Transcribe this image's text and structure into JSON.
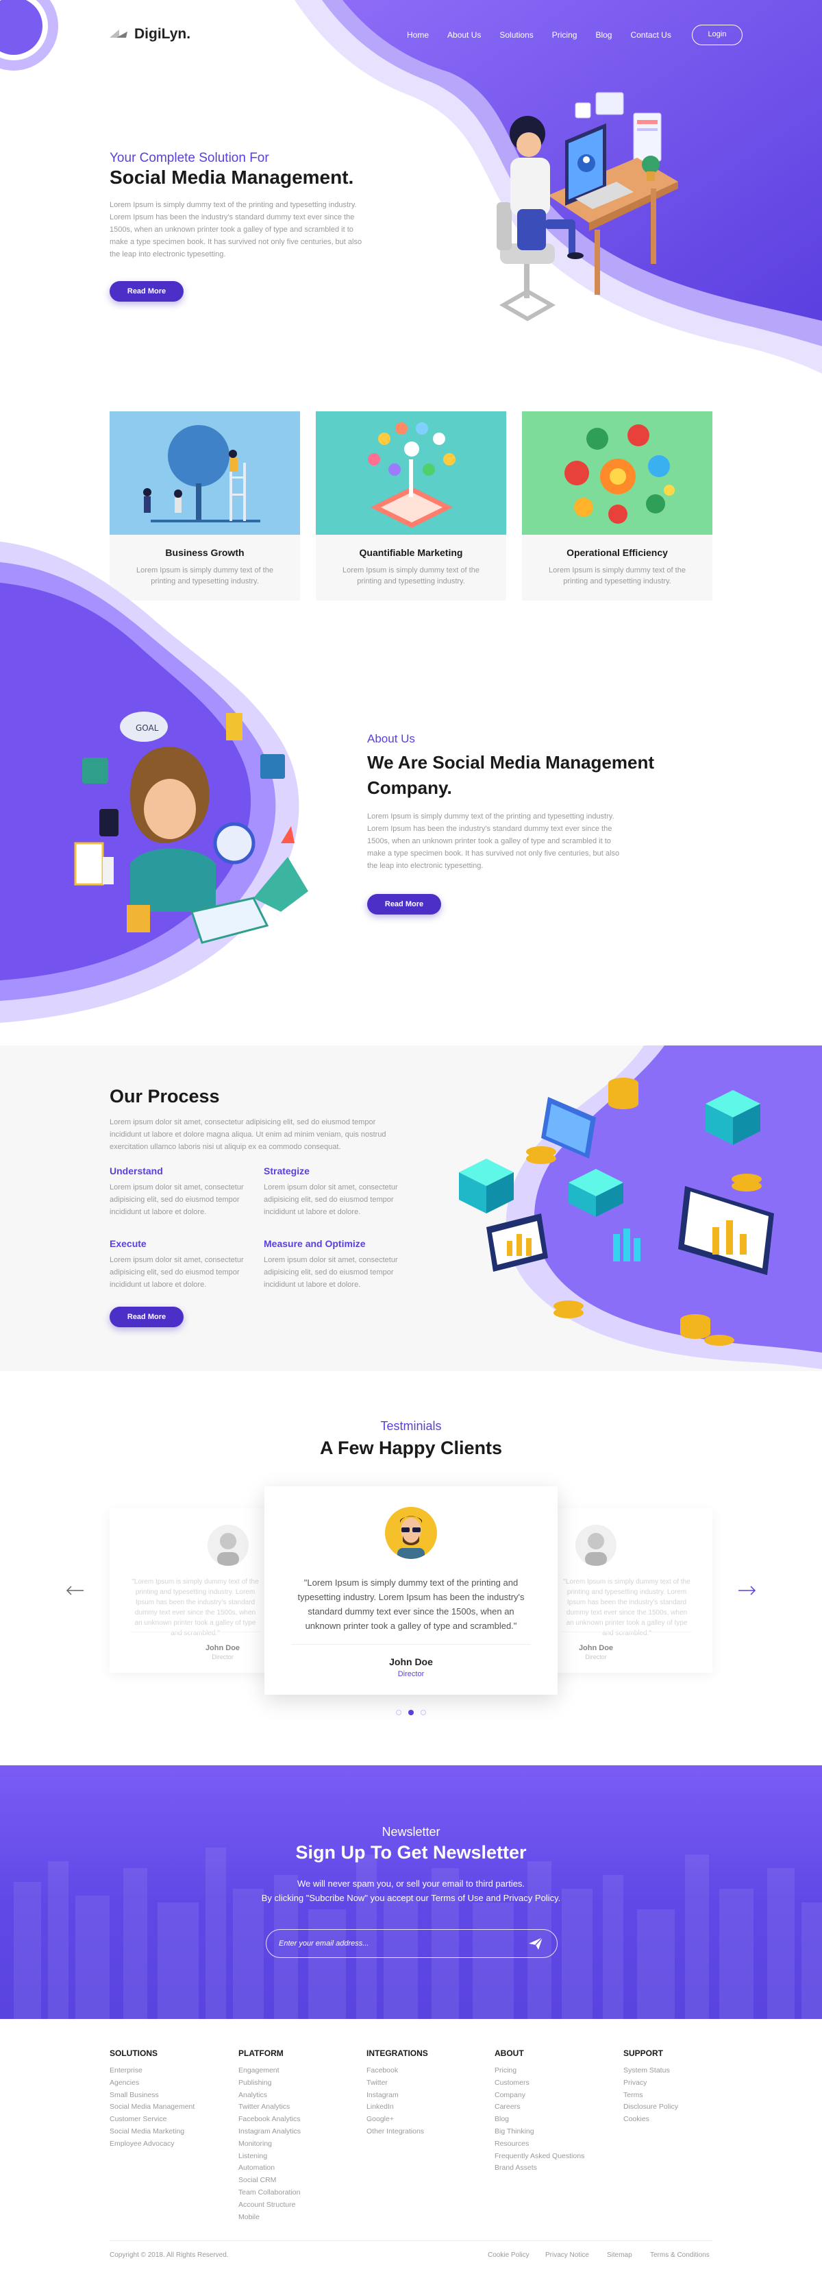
{
  "brand": {
    "name": "DigiLyn.",
    "accent": "#5b3fd9",
    "button": "#4b2fc7"
  },
  "nav": {
    "items": [
      "Home",
      "About Us",
      "Solutions",
      "Pricing",
      "Blog",
      "Contact Us"
    ],
    "login": "Login"
  },
  "hero": {
    "kicker": "Your Complete Solution For",
    "title": "Social Media Management.",
    "text": "Lorem Ipsum is simply dummy text of the printing and typesetting industry. Lorem Ipsum has been the industry's standard dummy text ever since the 1500s, when an unknown printer took a galley of type and scrambled it to make a type specimen book. It has survived not only five centuries, but also the leap into electronic typesetting.",
    "button": "Read More"
  },
  "features": [
    {
      "title": "Business Growth",
      "text": "Lorem Ipsum is simply dummy text of the printing and typesetting industry.",
      "bg": "#8ecbef"
    },
    {
      "title": "Quantifiable Marketing",
      "text": "Lorem Ipsum is simply dummy text of the printing and typesetting industry.",
      "bg": "#5ccfc8"
    },
    {
      "title": "Operational Efficiency",
      "text": "Lorem Ipsum is simply dummy text of the printing and typesetting industry.",
      "bg": "#7ddc99"
    }
  ],
  "about": {
    "kicker": "About Us",
    "title": "We Are Social Media Management Company.",
    "text": "Lorem Ipsum is simply dummy text of the printing and typesetting industry. Lorem Ipsum has been the industry's standard dummy text ever since the 1500s, when an unknown printer took a galley of type and scrambled it to make a type specimen book. It has survived not only five centuries, but also the leap into electronic typesetting.",
    "button": "Read More",
    "goal_label": "GOAL"
  },
  "process": {
    "title": "Our Process",
    "intro": "Lorem ipsum dolor sit amet, consectetur adipisicing elit, sed do eiusmod tempor incididunt ut labore et dolore magna aliqua. Ut enim ad minim veniam, quis nostrud exercitation ullamco laboris nisi ut aliquip ex ea commodo consequat.",
    "steps": [
      {
        "title": "Understand",
        "text": "Lorem ipsum dolor sit amet, consectetur adipisicing elit, sed do eiusmod tempor incididunt ut labore et dolore."
      },
      {
        "title": "Strategize",
        "text": "Lorem ipsum dolor sit amet, consectetur adipisicing elit, sed do eiusmod tempor incididunt ut labore et dolore."
      },
      {
        "title": "Execute",
        "text": "Lorem ipsum dolor sit amet, consectetur adipisicing elit, sed do eiusmod tempor incididunt ut labore et dolore."
      },
      {
        "title": "Measure and Optimize",
        "text": "Lorem ipsum dolor sit amet, consectetur adipisicing elit, sed do eiusmod tempor incididunt ut labore et dolore."
      }
    ],
    "button": "Read More"
  },
  "testimonials": {
    "kicker": "Testminials",
    "title": "A Few Happy Clients",
    "center": {
      "quote": "\"Lorem Ipsum is simply dummy text of the printing and typesetting industry. Lorem Ipsum has been the industry's standard dummy text ever since the 1500s, when an unknown printer took a galley of type and scrambled.\"",
      "name": "John Doe",
      "role": "Director"
    },
    "left": {
      "quote": "\"Lorem Ipsum is simply dummy text of the printing and typesetting industry. Lorem Ipsum has been the industry's standard dummy text ever since the 1500s, when an unknown printer took a galley of type and scrambled.\"",
      "name": "John Doe",
      "role": "Director"
    },
    "right": {
      "quote": "\"Lorem Ipsum is simply dummy text of the printing and typesetting industry. Lorem Ipsum has been the industry's standard dummy text ever since the 1500s, when an unknown printer took a galley of type and scrambled.\"",
      "name": "John Doe",
      "role": "Director"
    },
    "active_dot": 2
  },
  "newsletter": {
    "kicker": "Newsletter",
    "title": "Sign Up To Get Newsletter",
    "line1": "We will never spam you, or sell your email to third parties.",
    "line2": "By clicking \"Subcribe Now\" you accept our Terms of Use and Privacy Policy.",
    "placeholder": "Enter your email address..."
  },
  "footer": {
    "columns": [
      {
        "title": "SOLUTIONS",
        "items": [
          "Enterprise",
          "Agencies",
          "Small Business",
          "Social Media Management",
          "Customer Service",
          "Social Media Marketing",
          "Employee Advocacy"
        ]
      },
      {
        "title": "PLATFORM",
        "items": [
          "Engagement",
          "Publishing",
          "Analytics",
          "Twitter Analytics",
          "Facebook Analytics",
          "Instagram Analytics",
          "Monitoring",
          "Listening",
          "Automation",
          "Social CRM",
          "Team Collaboration",
          "Account Structure",
          "Mobile"
        ]
      },
      {
        "title": "INTEGRATIONS",
        "items": [
          "Facebook",
          "Twitter",
          "Instagram",
          "LinkedIn",
          "Google+",
          "Other Integrations"
        ]
      },
      {
        "title": "ABOUT",
        "items": [
          "Pricing",
          "Customers",
          "Company",
          "Careers",
          "Blog",
          "Big Thinking",
          "Resources",
          "Frequently Asked Questions",
          "Brand Assets"
        ]
      },
      {
        "title": "SUPPORT",
        "items": [
          "System Status",
          "Privacy",
          "Terms",
          "Disclosure Policy",
          "Cookies"
        ]
      }
    ],
    "copyright": "Copyright © 2018. All Rights Reserved.",
    "links": [
      "Cookie Policy",
      "Privacy Notice",
      "Sitemap",
      "Terms & Conditions"
    ]
  }
}
